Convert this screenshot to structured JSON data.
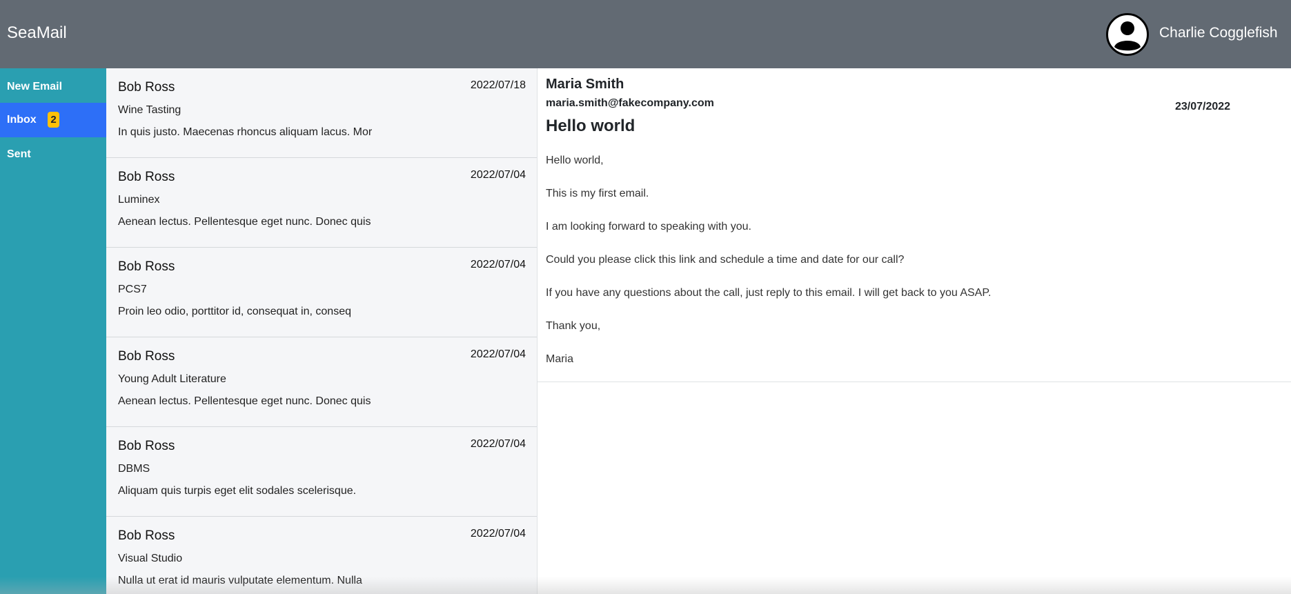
{
  "app": {
    "title": "SeaMail"
  },
  "user": {
    "name": "Charlie Cogglefish"
  },
  "colors": {
    "topbar": "#626a73",
    "sidebar": "#2a9fb1",
    "active_nav": "#2d6ff7",
    "badge": "#ffc107"
  },
  "sidebar": {
    "items": [
      {
        "label": "New Email"
      },
      {
        "label": "Inbox",
        "badge": "2"
      },
      {
        "label": "Sent"
      }
    ]
  },
  "emails": [
    {
      "sender": "Bob Ross",
      "date": "2022/07/18",
      "subject": "Wine Tasting",
      "snippet": "In quis justo. Maecenas rhoncus aliquam lacus. Mor"
    },
    {
      "sender": "Bob Ross",
      "date": "2022/07/04",
      "subject": "Luminex",
      "snippet": "Aenean lectus. Pellentesque eget nunc. Donec quis"
    },
    {
      "sender": "Bob Ross",
      "date": "2022/07/04",
      "subject": "PCS7",
      "snippet": "Proin leo odio, porttitor id, consequat in, conseq"
    },
    {
      "sender": "Bob Ross",
      "date": "2022/07/04",
      "subject": "Young Adult Literature",
      "snippet": "Aenean lectus. Pellentesque eget nunc. Donec quis"
    },
    {
      "sender": "Bob Ross",
      "date": "2022/07/04",
      "subject": "DBMS",
      "snippet": "Aliquam quis turpis eget elit sodales scelerisque."
    },
    {
      "sender": "Bob Ross",
      "date": "2022/07/04",
      "subject": "Visual Studio",
      "snippet": "Nulla ut erat id mauris vulputate elementum. Nulla"
    }
  ],
  "reader": {
    "from_name": "Maria Smith",
    "from_email": "maria.smith@fakecompany.com",
    "date": "23/07/2022",
    "subject": "Hello world",
    "body": [
      "Hello world,",
      "This is my first email.",
      "I am looking forward to speaking with you.",
      "Could you please click this link and schedule a time and date for our call?",
      "If you have any questions about the call, just reply to this email. I will get back to you ASAP.",
      "Thank you,",
      "Maria"
    ]
  }
}
